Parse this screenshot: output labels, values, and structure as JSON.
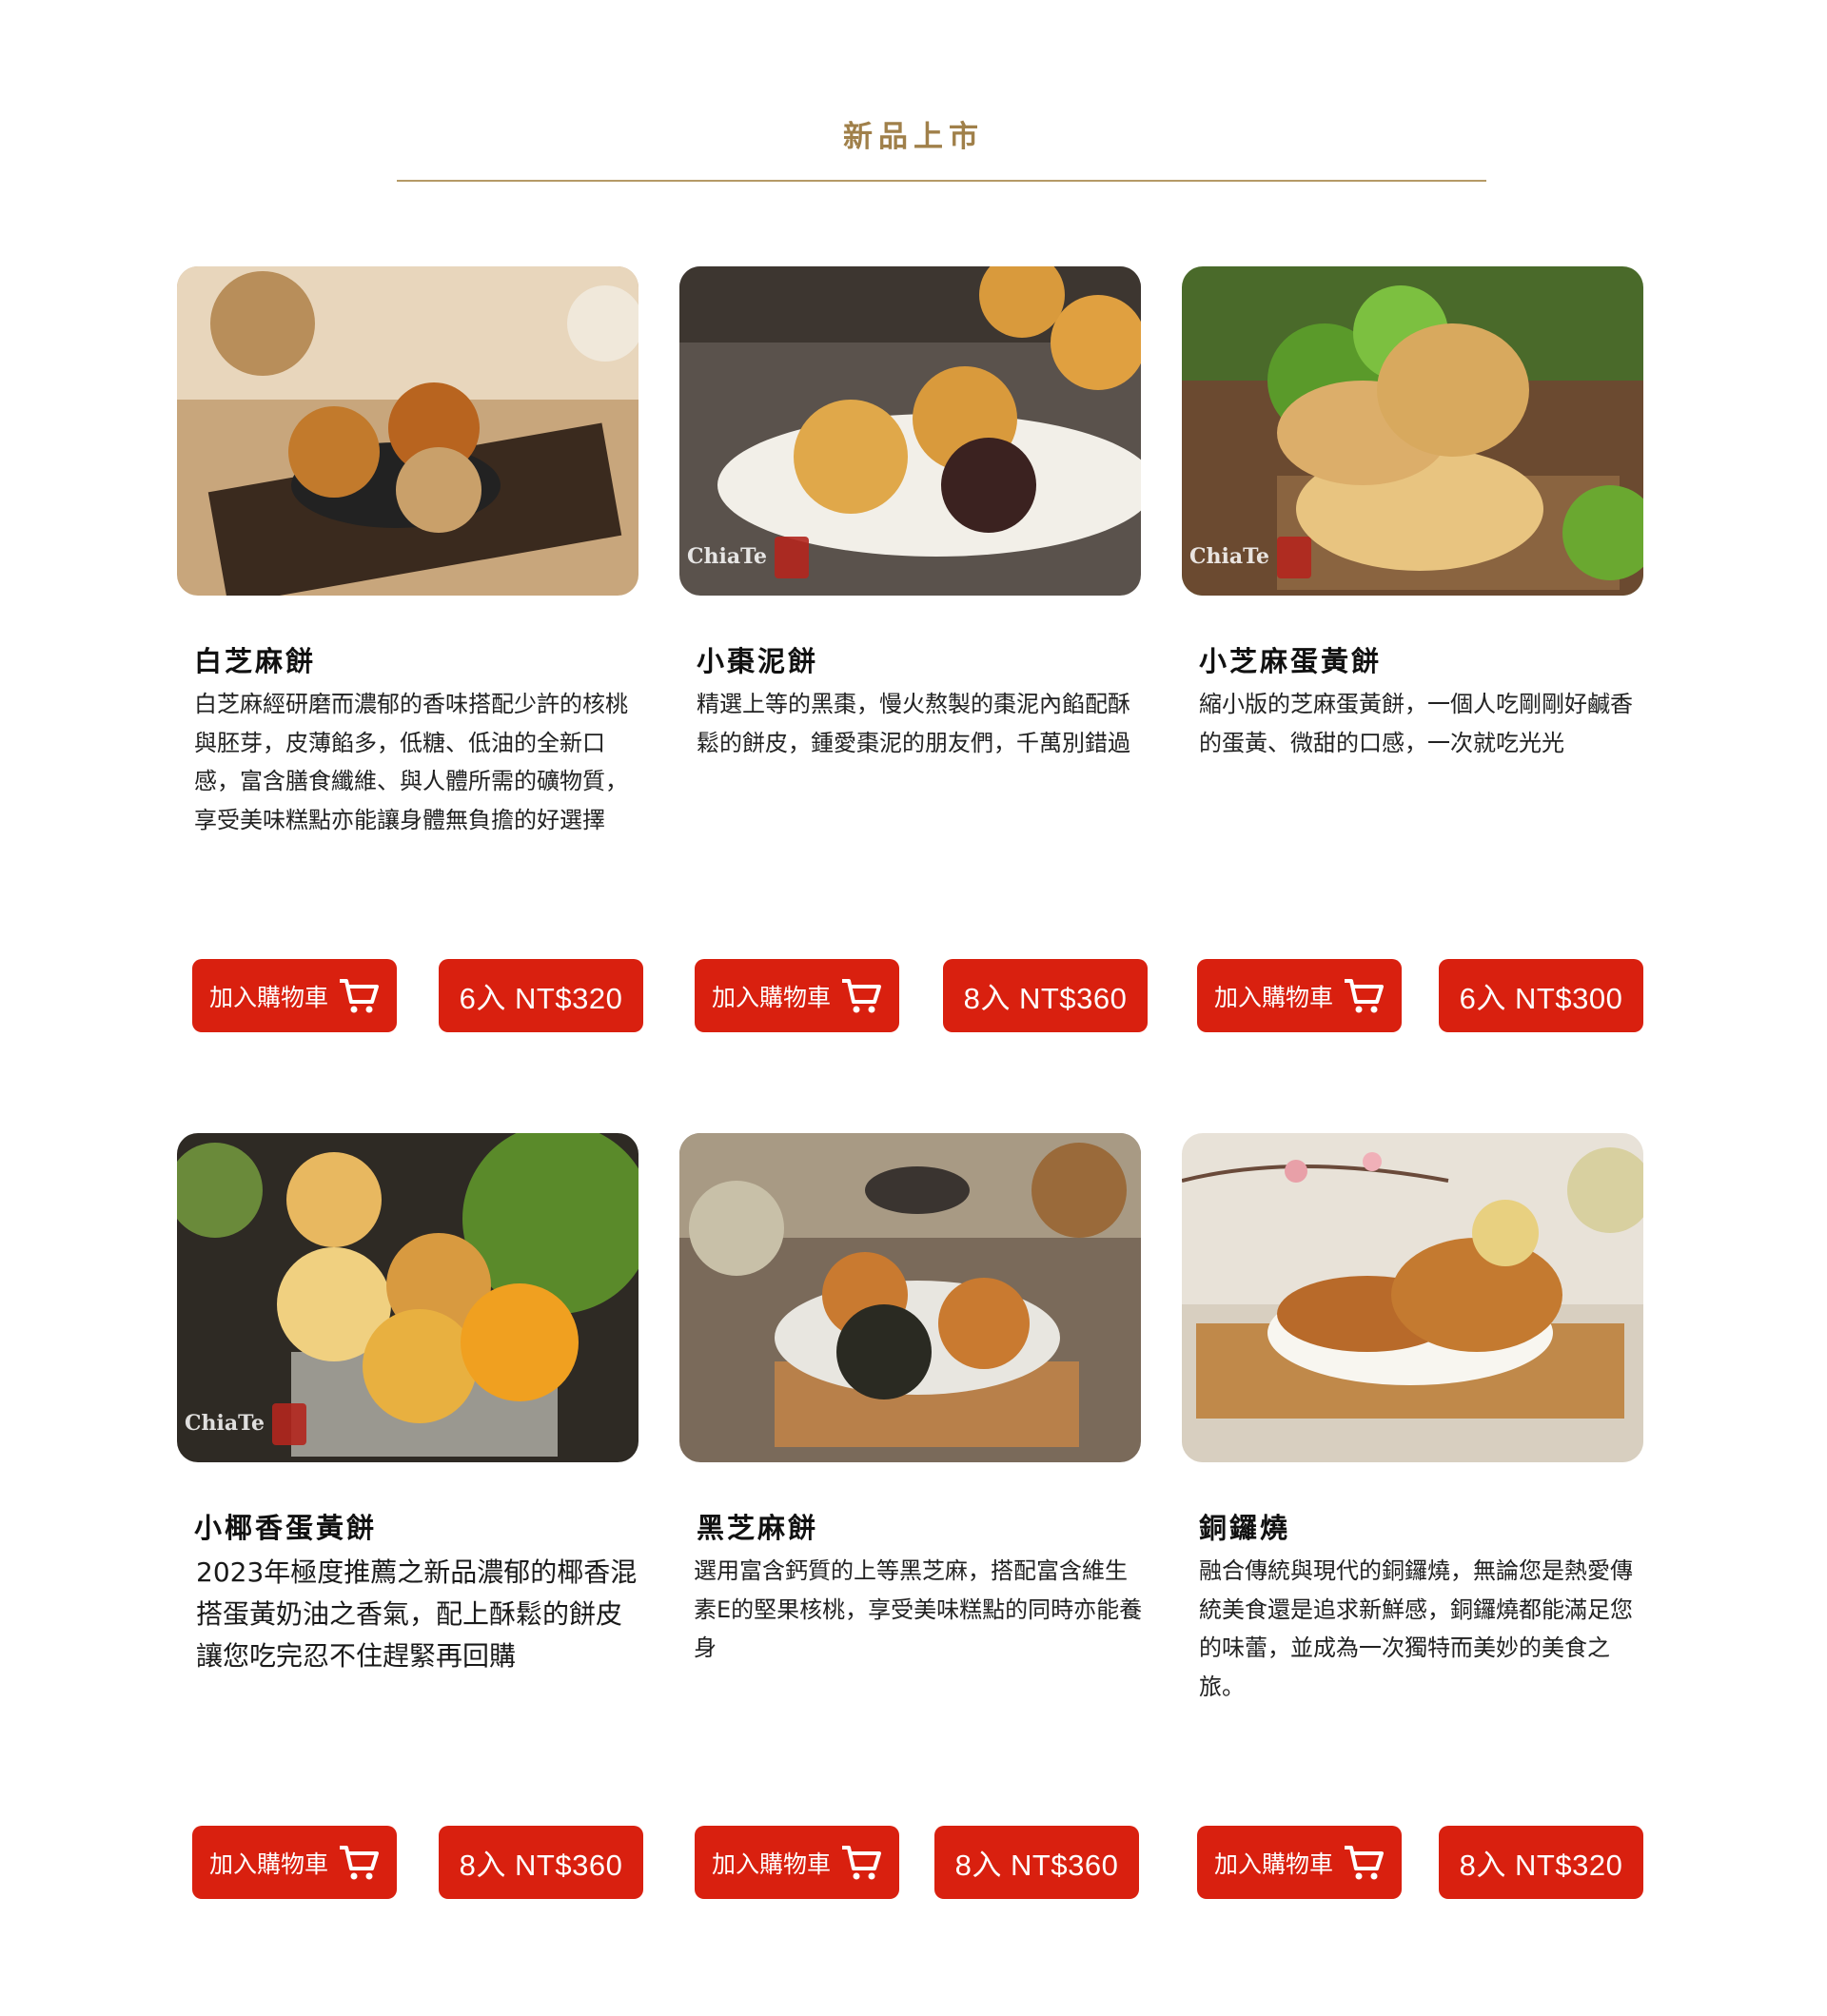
{
  "section": {
    "title": "新品上市"
  },
  "watermark": "ChiaTe",
  "products": [
    {
      "name": "白芝麻餅",
      "description": "白芝麻經研磨而濃郁的香味搭配少許的核桃與胚芽，皮薄餡多，低糖、低油的全新口感，富含膳食纖維、與人體所需的礦物質，享受美味糕點亦能讓身體無負擔的好選擇",
      "cart_label": "加入購物車",
      "price_label": "6入 NT$320",
      "cart_icon": "shopping-cart-icon"
    },
    {
      "name": "小棗泥餅",
      "description": "精選上等的黑棗，慢火熬製的棗泥內餡配酥鬆的餅皮，鍾愛棗泥的朋友們，千萬別錯過",
      "cart_label": "加入購物車",
      "price_label": "8入 NT$360",
      "cart_icon": "shopping-cart-icon"
    },
    {
      "name": "小芝麻蛋黃餅",
      "description": "縮小版的芝麻蛋黃餅，一個人吃剛剛好鹹香的蛋黃、微甜的口感，一次就吃光光",
      "cart_label": "加入購物車",
      "price_label": "6入 NT$300",
      "cart_icon": "shopping-cart-icon"
    },
    {
      "name": "小椰香蛋黃餅",
      "description": "2023年極度推薦之新品濃郁的椰香混搭蛋黃奶油之香氣，配上酥鬆的餅皮讓您吃完忍不住趕緊再回購",
      "cart_label": "加入購物車",
      "price_label": "8入 NT$360",
      "cart_icon": "shopping-cart-icon"
    },
    {
      "name": "黑芝麻餅",
      "description": "選用富含鈣質的上等黑芝麻，搭配富含維生素E的堅果核桃，享受美味糕點的同時亦能養身",
      "cart_label": "加入購物車",
      "price_label": "8入 NT$360",
      "cart_icon": "shopping-cart-icon"
    },
    {
      "name": "銅鑼燒",
      "description": "融合傳統與現代的銅鑼燒，無論您是熱愛傳統美食還是追求新鮮感，銅鑼燒都能滿足您的味蕾，並成為一次獨特而美妙的美食之旅。",
      "cart_label": "加入購物車",
      "price_label": "8入 NT$320",
      "cart_icon": "shopping-cart-icon"
    }
  ],
  "colors": {
    "accent": "#a0804a",
    "button": "#d9200f",
    "rule": "#b59a66"
  }
}
